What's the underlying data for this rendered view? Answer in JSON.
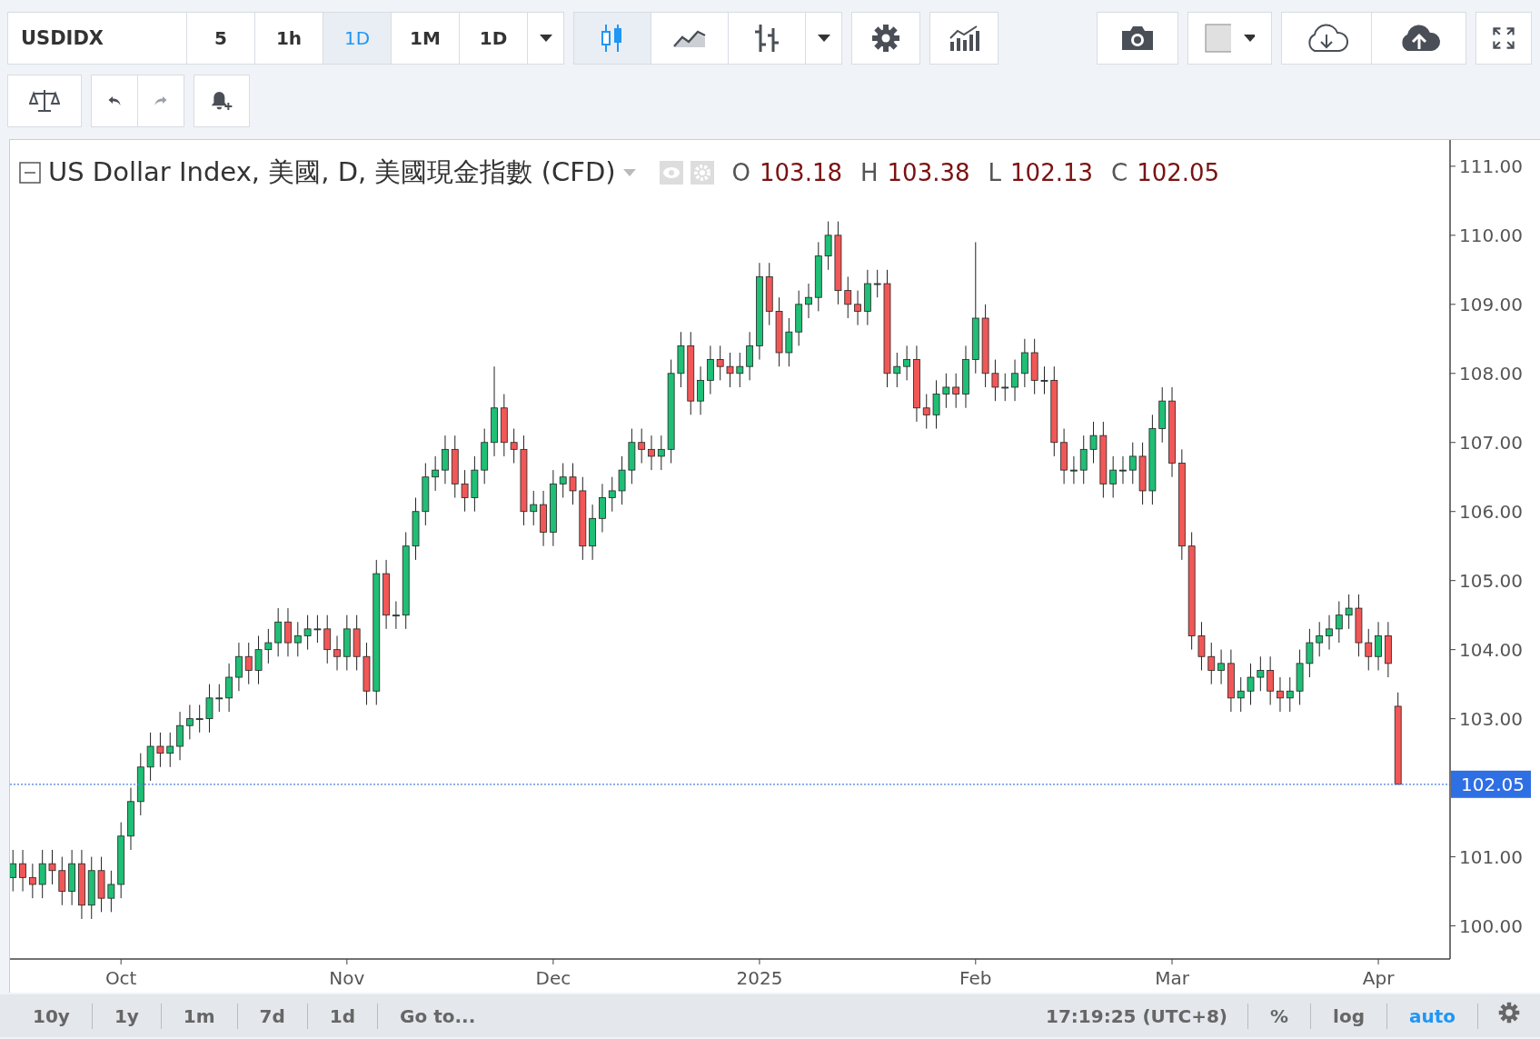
{
  "toolbar": {
    "symbol": "USDIDX",
    "intervals": [
      {
        "label": "5",
        "selected": false
      },
      {
        "label": "1h",
        "selected": false
      },
      {
        "label": "1D",
        "selected": true
      },
      {
        "label": "1M",
        "selected": false
      },
      {
        "label": "1D",
        "selected": false
      }
    ],
    "chart_styles": [
      {
        "kind": "candles",
        "selected": true
      },
      {
        "kind": "line",
        "selected": false
      },
      {
        "kind": "bars",
        "selected": false
      }
    ]
  },
  "legend": {
    "title": "US Dollar Index, 美國, D, 美國現金指數 (CFD)",
    "values": [
      {
        "key": "O",
        "value": "103.18"
      },
      {
        "key": "H",
        "value": "103.38"
      },
      {
        "key": "L",
        "value": "102.13"
      },
      {
        "key": "C",
        "value": "102.05"
      }
    ]
  },
  "chart": {
    "chart_data": {
      "type": "candlestick",
      "ylim": [
        99.52,
        111.38
      ],
      "yticks": [
        {
          "value": 100,
          "label": "100.00"
        },
        {
          "value": 101,
          "label": "101.00"
        },
        {
          "value": 103,
          "label": "103.00"
        },
        {
          "value": 104,
          "label": "104.00"
        },
        {
          "value": 105,
          "label": "105.00"
        },
        {
          "value": 106,
          "label": "106.00"
        },
        {
          "value": 107,
          "label": "107.00"
        },
        {
          "value": 108,
          "label": "108.00"
        },
        {
          "value": 109,
          "label": "109.00"
        },
        {
          "value": 110,
          "label": "110.00"
        },
        {
          "value": 111,
          "label": "111.00"
        }
      ],
      "ref_lines": [
        {
          "axis": "y",
          "value": 102.05,
          "label": "102.05",
          "color": "#4a7ee0"
        }
      ],
      "categories": [
        null,
        null,
        null,
        null,
        null,
        null,
        null,
        null,
        null,
        null,
        null,
        "Oct",
        null,
        null,
        null,
        null,
        null,
        null,
        null,
        null,
        null,
        null,
        null,
        null,
        null,
        null,
        null,
        null,
        null,
        null,
        null,
        null,
        null,
        null,
        "Nov",
        null,
        null,
        null,
        null,
        null,
        null,
        null,
        null,
        null,
        null,
        null,
        null,
        null,
        null,
        null,
        null,
        null,
        null,
        null,
        null,
        "Dec",
        null,
        null,
        null,
        null,
        null,
        null,
        null,
        null,
        null,
        null,
        null,
        null,
        null,
        null,
        null,
        null,
        null,
        null,
        null,
        null,
        "2025",
        null,
        null,
        null,
        null,
        null,
        null,
        null,
        null,
        null,
        null,
        null,
        null,
        null,
        null,
        null,
        null,
        null,
        null,
        null,
        null,
        null,
        "Feb",
        null,
        null,
        null,
        null,
        null,
        null,
        null,
        null,
        null,
        null,
        null,
        null,
        null,
        null,
        null,
        null,
        null,
        null,
        null,
        "Mar",
        null,
        null,
        null,
        null,
        null,
        null,
        null,
        null,
        null,
        null,
        null,
        null,
        null,
        null,
        null,
        null,
        null,
        null,
        null,
        null,
        "Apr",
        null,
        null
      ],
      "ohlc": [
        [
          100.7,
          101.1,
          100.5,
          100.9
        ],
        [
          100.9,
          101.1,
          100.5,
          100.7
        ],
        [
          100.7,
          100.9,
          100.4,
          100.6
        ],
        [
          100.6,
          101.1,
          100.4,
          100.9
        ],
        [
          100.9,
          101.1,
          100.6,
          100.8
        ],
        [
          100.8,
          101.0,
          100.3,
          100.5
        ],
        [
          100.5,
          101.1,
          100.3,
          100.9
        ],
        [
          100.9,
          101.1,
          100.1,
          100.3
        ],
        [
          100.3,
          101.0,
          100.1,
          100.8
        ],
        [
          100.8,
          101.0,
          100.2,
          100.4
        ],
        [
          100.4,
          100.8,
          100.2,
          100.6
        ],
        [
          100.6,
          101.5,
          100.4,
          101.3
        ],
        [
          101.3,
          102.0,
          101.1,
          101.8
        ],
        [
          101.8,
          102.5,
          101.6,
          102.3
        ],
        [
          102.3,
          102.8,
          102.1,
          102.6
        ],
        [
          102.6,
          102.8,
          102.3,
          102.5
        ],
        [
          102.5,
          102.8,
          102.3,
          102.6
        ],
        [
          102.6,
          103.1,
          102.4,
          102.9
        ],
        [
          102.9,
          103.2,
          102.7,
          103.0
        ],
        [
          103.0,
          103.2,
          102.8,
          103.0
        ],
        [
          103.0,
          103.5,
          102.8,
          103.3
        ],
        [
          103.3,
          103.5,
          103.1,
          103.3
        ],
        [
          103.3,
          103.8,
          103.1,
          103.6
        ],
        [
          103.6,
          104.1,
          103.4,
          103.9
        ],
        [
          103.9,
          104.1,
          103.5,
          103.7
        ],
        [
          103.7,
          104.2,
          103.5,
          104.0
        ],
        [
          104.0,
          104.3,
          103.8,
          104.1
        ],
        [
          104.1,
          104.6,
          103.9,
          104.4
        ],
        [
          104.4,
          104.6,
          103.9,
          104.1
        ],
        [
          104.1,
          104.4,
          103.9,
          104.2
        ],
        [
          104.2,
          104.5,
          104.0,
          104.3
        ],
        [
          104.3,
          104.5,
          104.1,
          104.3
        ],
        [
          104.3,
          104.5,
          103.8,
          104.0
        ],
        [
          104.0,
          104.2,
          103.7,
          103.9
        ],
        [
          103.9,
          104.5,
          103.7,
          104.3
        ],
        [
          104.3,
          104.5,
          103.7,
          103.9
        ],
        [
          103.9,
          104.1,
          103.2,
          103.4
        ],
        [
          103.4,
          105.3,
          103.2,
          105.1
        ],
        [
          105.1,
          105.3,
          104.3,
          104.5
        ],
        [
          104.5,
          104.7,
          104.3,
          104.5
        ],
        [
          104.5,
          105.7,
          104.3,
          105.5
        ],
        [
          105.5,
          106.2,
          105.3,
          106.0
        ],
        [
          106.0,
          106.7,
          105.8,
          106.5
        ],
        [
          106.5,
          106.8,
          106.3,
          106.6
        ],
        [
          106.6,
          107.1,
          106.4,
          106.9
        ],
        [
          106.9,
          107.1,
          106.2,
          106.4
        ],
        [
          106.4,
          106.6,
          106.0,
          106.2
        ],
        [
          106.2,
          106.8,
          106.0,
          106.6
        ],
        [
          106.6,
          107.2,
          106.4,
          107.0
        ],
        [
          107.0,
          108.1,
          106.8,
          107.5
        ],
        [
          107.5,
          107.7,
          106.8,
          107.0
        ],
        [
          107.0,
          107.2,
          106.7,
          106.9
        ],
        [
          106.9,
          107.1,
          105.8,
          106.0
        ],
        [
          106.0,
          106.3,
          105.8,
          106.1
        ],
        [
          106.1,
          106.3,
          105.5,
          105.7
        ],
        [
          105.7,
          106.6,
          105.5,
          106.4
        ],
        [
          106.4,
          106.7,
          106.2,
          106.5
        ],
        [
          106.5,
          106.7,
          106.1,
          106.3
        ],
        [
          106.3,
          106.5,
          105.3,
          105.5
        ],
        [
          105.5,
          106.1,
          105.3,
          105.9
        ],
        [
          105.9,
          106.4,
          105.7,
          106.2
        ],
        [
          106.2,
          106.5,
          106.0,
          106.3
        ],
        [
          106.3,
          106.8,
          106.1,
          106.6
        ],
        [
          106.6,
          107.2,
          106.4,
          107.0
        ],
        [
          107.0,
          107.2,
          106.7,
          106.9
        ],
        [
          106.9,
          107.1,
          106.6,
          106.8
        ],
        [
          106.8,
          107.1,
          106.6,
          106.9
        ],
        [
          106.9,
          108.2,
          106.7,
          108.0
        ],
        [
          108.0,
          108.6,
          107.8,
          108.4
        ],
        [
          108.4,
          108.6,
          107.4,
          107.6
        ],
        [
          107.6,
          108.1,
          107.4,
          107.9
        ],
        [
          107.9,
          108.4,
          107.7,
          108.2
        ],
        [
          108.2,
          108.4,
          107.9,
          108.1
        ],
        [
          108.1,
          108.3,
          107.8,
          108.0
        ],
        [
          108.0,
          108.3,
          107.8,
          108.1
        ],
        [
          108.1,
          108.6,
          107.9,
          108.4
        ],
        [
          108.4,
          109.6,
          108.2,
          109.4
        ],
        [
          109.4,
          109.6,
          108.7,
          108.9
        ],
        [
          108.9,
          109.1,
          108.1,
          108.3
        ],
        [
          108.3,
          108.8,
          108.1,
          108.6
        ],
        [
          108.6,
          109.2,
          108.4,
          109.0
        ],
        [
          109.0,
          109.3,
          108.8,
          109.1
        ],
        [
          109.1,
          109.9,
          108.9,
          109.7
        ],
        [
          109.7,
          110.2,
          109.5,
          110.0
        ],
        [
          110.0,
          110.2,
          109.0,
          109.2
        ],
        [
          109.2,
          109.4,
          108.8,
          109.0
        ],
        [
          109.0,
          109.2,
          108.7,
          108.9
        ],
        [
          108.9,
          109.5,
          108.7,
          109.3
        ],
        [
          109.3,
          109.5,
          109.1,
          109.3
        ],
        [
          109.3,
          109.5,
          107.8,
          108.0
        ],
        [
          108.0,
          108.3,
          107.8,
          108.1
        ],
        [
          108.1,
          108.4,
          107.9,
          108.2
        ],
        [
          108.2,
          108.4,
          107.3,
          107.5
        ],
        [
          107.5,
          107.7,
          107.2,
          107.4
        ],
        [
          107.4,
          107.9,
          107.2,
          107.7
        ],
        [
          107.7,
          108.0,
          107.5,
          107.8
        ],
        [
          107.8,
          108.0,
          107.5,
          107.7
        ],
        [
          107.7,
          108.4,
          107.5,
          108.2
        ],
        [
          108.2,
          109.9,
          108.0,
          108.8
        ],
        [
          108.8,
          109.0,
          107.8,
          108.0
        ],
        [
          108.0,
          108.2,
          107.6,
          107.8
        ],
        [
          107.8,
          108.0,
          107.6,
          107.8
        ],
        [
          107.8,
          108.2,
          107.6,
          108.0
        ],
        [
          108.0,
          108.5,
          107.8,
          108.3
        ],
        [
          108.3,
          108.5,
          107.7,
          107.9
        ],
        [
          107.9,
          108.1,
          107.7,
          107.9
        ],
        [
          107.9,
          108.1,
          106.8,
          107.0
        ],
        [
          107.0,
          107.2,
          106.4,
          106.6
        ],
        [
          106.6,
          106.8,
          106.4,
          106.6
        ],
        [
          106.6,
          107.1,
          106.4,
          106.9
        ],
        [
          106.9,
          107.3,
          106.7,
          107.1
        ],
        [
          107.1,
          107.3,
          106.2,
          106.4
        ],
        [
          106.4,
          106.8,
          106.2,
          106.6
        ],
        [
          106.6,
          106.8,
          106.4,
          106.6
        ],
        [
          106.6,
          107.0,
          106.4,
          106.8
        ],
        [
          106.8,
          107.0,
          106.1,
          106.3
        ],
        [
          106.3,
          107.4,
          106.1,
          107.2
        ],
        [
          107.2,
          107.8,
          107.0,
          107.6
        ],
        [
          107.6,
          107.8,
          106.5,
          106.7
        ],
        [
          106.7,
          106.9,
          105.3,
          105.5
        ],
        [
          105.5,
          105.7,
          104.0,
          104.2
        ],
        [
          104.2,
          104.4,
          103.7,
          103.9
        ],
        [
          103.9,
          104.1,
          103.5,
          103.7
        ],
        [
          103.7,
          104.0,
          103.5,
          103.8
        ],
        [
          103.8,
          104.0,
          103.1,
          103.3
        ],
        [
          103.3,
          103.6,
          103.1,
          103.4
        ],
        [
          103.4,
          103.8,
          103.2,
          103.6
        ],
        [
          103.6,
          103.9,
          103.4,
          103.7
        ],
        [
          103.7,
          103.9,
          103.2,
          103.4
        ],
        [
          103.4,
          103.6,
          103.1,
          103.3
        ],
        [
          103.3,
          103.6,
          103.1,
          103.4
        ],
        [
          103.4,
          104.0,
          103.2,
          103.8
        ],
        [
          103.8,
          104.3,
          103.6,
          104.1
        ],
        [
          104.1,
          104.4,
          103.9,
          104.2
        ],
        [
          104.2,
          104.5,
          104.0,
          104.3
        ],
        [
          104.3,
          104.7,
          104.1,
          104.5
        ],
        [
          104.5,
          104.8,
          104.3,
          104.6
        ],
        [
          104.6,
          104.8,
          103.9,
          104.1
        ],
        [
          104.1,
          104.3,
          103.7,
          103.9
        ],
        [
          103.9,
          104.4,
          103.7,
          104.2
        ],
        [
          104.2,
          104.4,
          103.6,
          103.8
        ],
        [
          103.18,
          103.38,
          102.05,
          102.05
        ]
      ]
    }
  },
  "bottom_bar": {
    "ranges": [
      "10y",
      "1y",
      "1m",
      "7d",
      "1d"
    ],
    "goto": "Go to...",
    "clock": "17:19:25 (UTC+8)",
    "scale_options": [
      {
        "label": "%",
        "selected": false
      },
      {
        "label": "log",
        "selected": false
      },
      {
        "label": "auto",
        "selected": true
      }
    ]
  }
}
